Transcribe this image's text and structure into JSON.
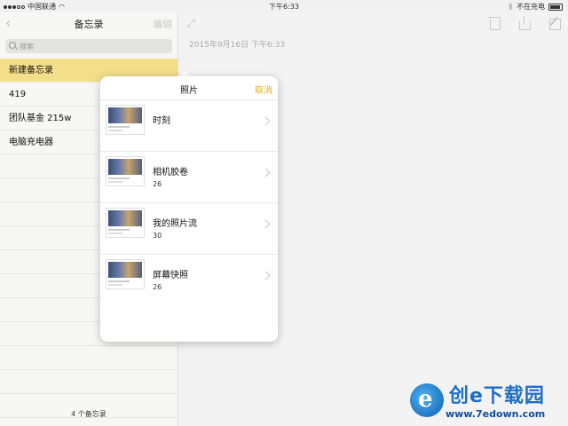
{
  "status_bar": {
    "carrier": "中国联通",
    "time": "下午6:33",
    "charging": "不在充电"
  },
  "sidebar": {
    "title": "备忘录",
    "edit_label": "编辑",
    "search_placeholder": "搜索",
    "notes": [
      "新建备忘录",
      "419",
      "团队基金 215w",
      "电脑充电器"
    ],
    "footer": "4 个备忘录"
  },
  "editor": {
    "date": "2015年9月16日 下午6:33"
  },
  "popover": {
    "title": "照片",
    "cancel_label": "取消",
    "albums": [
      {
        "name": "时刻",
        "count": ""
      },
      {
        "name": "相机胶卷",
        "count": "26"
      },
      {
        "name": "我的照片流",
        "count": "30"
      },
      {
        "name": "屏幕快照",
        "count": "26"
      }
    ]
  },
  "watermark": {
    "title": "创e下载园",
    "url": "www.7edown.com"
  },
  "icons": [
    "back-icon",
    "search-icon",
    "expand-icon",
    "trash-icon",
    "share-icon",
    "compose-icon",
    "chevron-right-icon",
    "wifi-icon",
    "bluetooth-icon",
    "battery-icon"
  ]
}
